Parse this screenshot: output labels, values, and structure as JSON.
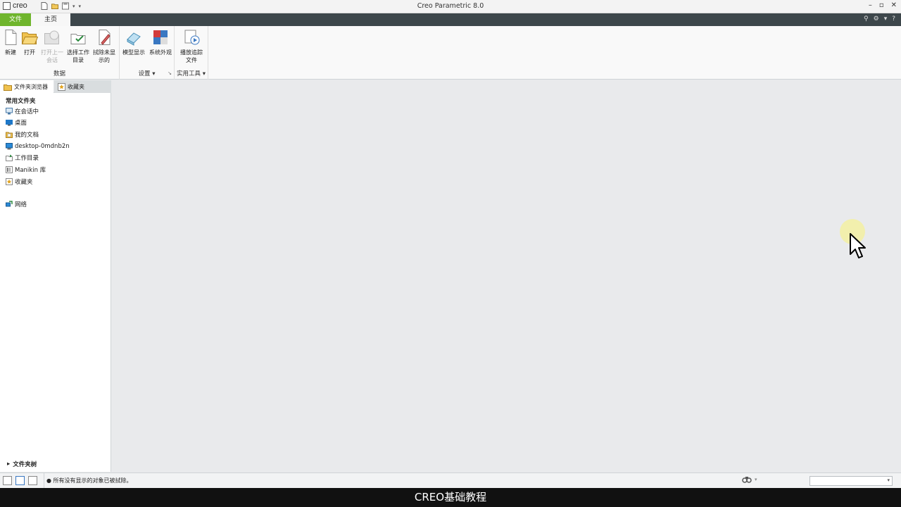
{
  "titlebar": {
    "logo_text": "creo",
    "app_title": "Creo Parametric 8.0",
    "controls": [
      "–",
      "▫",
      "✕"
    ]
  },
  "tabs": {
    "file": "文件",
    "home": "主页",
    "right_icons": [
      "⚲",
      "⚙",
      "▾",
      "?"
    ]
  },
  "ribbon": {
    "groups": {
      "data": "数据",
      "settings": "设置",
      "utilities": "实用工具"
    },
    "buttons": {
      "new": "新建",
      "open": "打开",
      "open_last_1": "打开上一",
      "open_last_2": "会话",
      "select_wd_1": "选择工作",
      "select_wd_2": "目录",
      "erase_1": "拭除未显",
      "erase_2": "示的",
      "model_display": "模型显示",
      "system_appearance": "系统外观",
      "playback_1": "播放追踪",
      "playback_2": "文件"
    }
  },
  "leftpanel": {
    "tab_browser": "文件夹浏览器",
    "tab_favorites": "收藏夹",
    "section_title": "常用文件夹",
    "items": [
      {
        "label": "在会话中",
        "icon": "monitor-icon"
      },
      {
        "label": "桌面",
        "icon": "desktop-icon"
      },
      {
        "label": "我的文档",
        "icon": "documents-icon"
      },
      {
        "label": "desktop-0mdnb2n",
        "icon": "computer-icon"
      },
      {
        "label": "工作目录",
        "icon": "working-dir-icon"
      },
      {
        "label": "Manikin 库",
        "icon": "library-icon"
      },
      {
        "label": "收藏夹",
        "icon": "favorites-icon"
      },
      {
        "label": "网络",
        "icon": "network-icon"
      }
    ],
    "tree_toggle": "文件夹树"
  },
  "statusbar": {
    "message": "● 所有没有显示的对象已被拭除。"
  },
  "caption": "CREO基础教程",
  "colors": {
    "file_tab": "#6fb52c",
    "tabbar": "#3d474b",
    "cursor_highlight": "#f3f0a6"
  }
}
